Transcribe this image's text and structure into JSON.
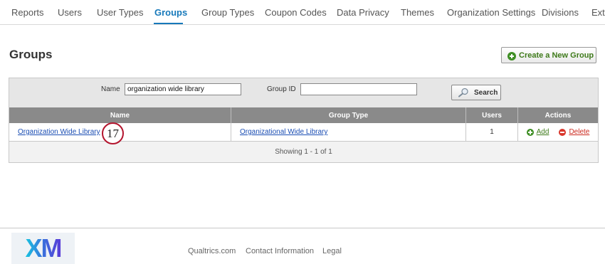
{
  "nav": {
    "tabs": [
      {
        "label": "Reports"
      },
      {
        "label": "Users"
      },
      {
        "label": "User Types"
      },
      {
        "label": "Groups"
      },
      {
        "label": "Group Types"
      },
      {
        "label": "Coupon Codes"
      },
      {
        "label": "Data Privacy"
      },
      {
        "label": "Themes"
      },
      {
        "label": "Organization Settings"
      },
      {
        "label": "Divisions"
      },
      {
        "label": "Exte"
      }
    ],
    "active": "Groups"
  },
  "page": {
    "title": "Groups",
    "create_label": "Create a New Group"
  },
  "filter": {
    "name_label": "Name",
    "name_value": "organization wide library",
    "group_id_label": "Group ID",
    "group_id_value": "",
    "search_label": "Search"
  },
  "table": {
    "columns": [
      "Name",
      "Group Type",
      "Users",
      "Actions"
    ],
    "rows": [
      {
        "name": "Organization Wide Library",
        "group_type": "Organizational Wide Library",
        "users": "1",
        "add_label": "Add",
        "delete_label": "Delete"
      }
    ],
    "status": "Showing 1 - 1 of  1"
  },
  "annotation": {
    "step": "17",
    "color": "#b3152e"
  },
  "footer": {
    "logo": "XM",
    "links": [
      "Qualtrics.com",
      "Contact Information",
      "Legal"
    ]
  },
  "colors": {
    "accent": "#1779ba",
    "link": "#1a4db3",
    "add": "#3f8f25",
    "delete": "#d9362b"
  }
}
